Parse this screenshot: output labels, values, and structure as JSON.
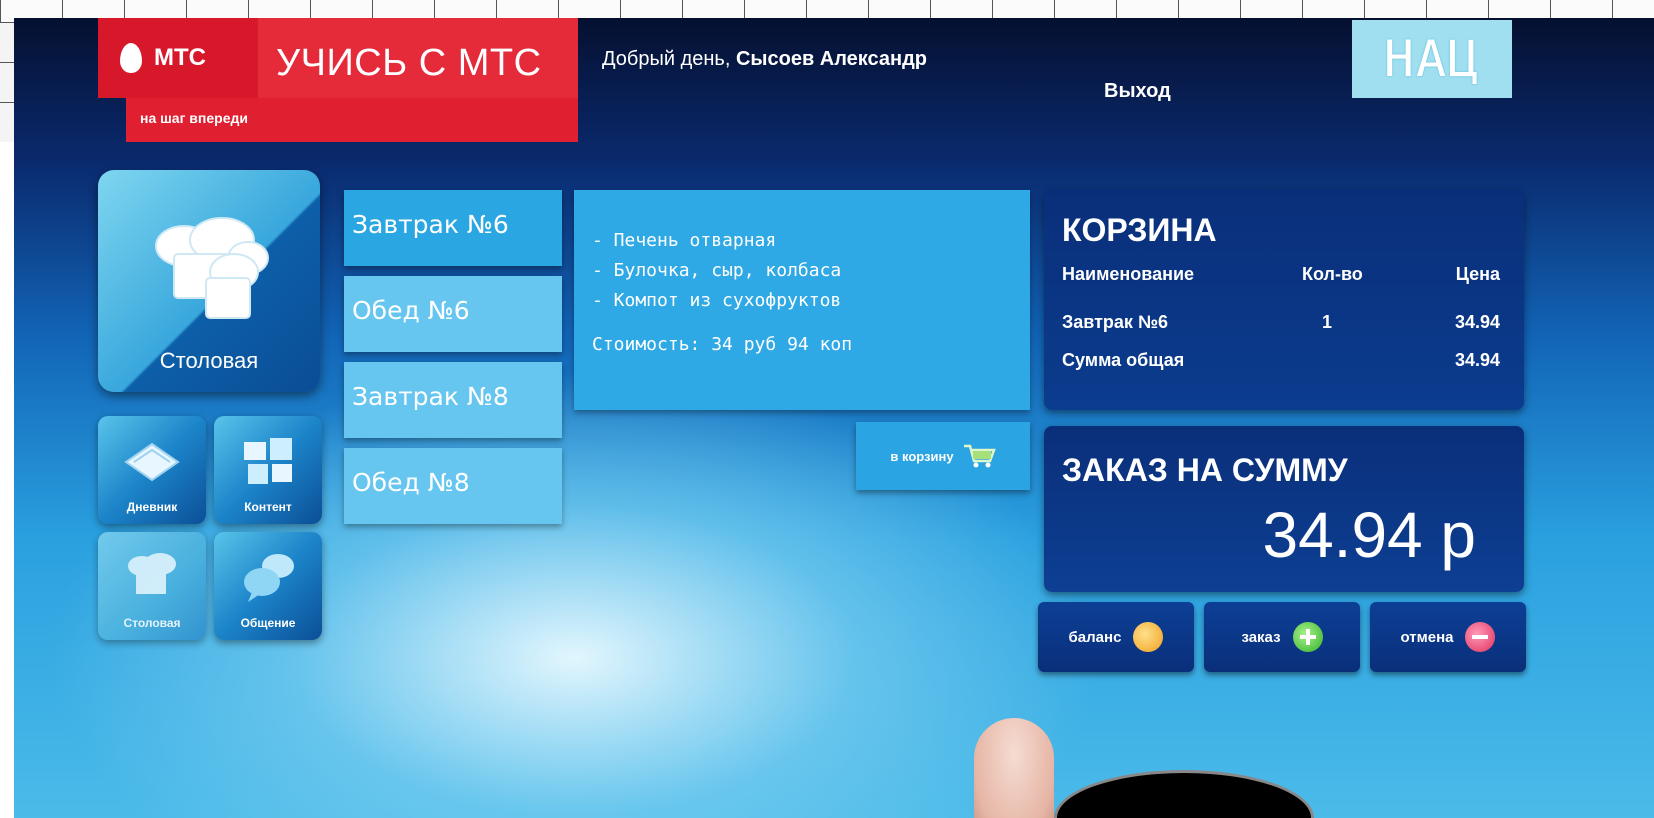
{
  "header": {
    "brand": "МТС",
    "title": "УЧИСЬ С МТС",
    "tagline": "на шаг впереди",
    "greeting_prefix": "Добрый день,",
    "user_name": "Сысоев Александр",
    "logout_label": "Выход",
    "partner_logo": "НАЦ"
  },
  "tiles": {
    "main_label": "Столовая",
    "small": [
      {
        "label": "Дневник",
        "icon": "book-icon"
      },
      {
        "label": "Контент",
        "icon": "blocks-icon"
      },
      {
        "label": "Столовая",
        "icon": "chef-hat-icon"
      },
      {
        "label": "Общение",
        "icon": "chat-icon"
      }
    ]
  },
  "menu": {
    "items": [
      {
        "label": "Завтрак №6"
      },
      {
        "label": "Обед №6"
      },
      {
        "label": "Завтрак №8"
      },
      {
        "label": "Обед №8"
      }
    ]
  },
  "detail": {
    "lines": [
      "- Печень отварная",
      "- Булочка, сыр, колбаса",
      "- Компот из сухофруктов"
    ],
    "cost": "Стоимость: 34 руб 94 коп",
    "add_to_cart_label": "в корзину"
  },
  "cart": {
    "title": "КОРЗИНА",
    "col_name": "Наименование",
    "col_qty": "Кол-во",
    "col_price": "Цена",
    "rows": [
      {
        "name": "Завтрак №6",
        "qty": "1",
        "price": "34.94"
      }
    ],
    "total_label": "Сумма общая",
    "total_value": "34.94"
  },
  "order": {
    "title": "ЗАКАЗ НА СУММУ",
    "total": "34.94 р"
  },
  "buttons": {
    "balance": "баланс",
    "order": "заказ",
    "cancel": "отмена"
  },
  "colors": {
    "brand_red": "#e52a3a",
    "panel_blue": "#2fa9e5",
    "dark_panel": "#0a2f7a"
  }
}
